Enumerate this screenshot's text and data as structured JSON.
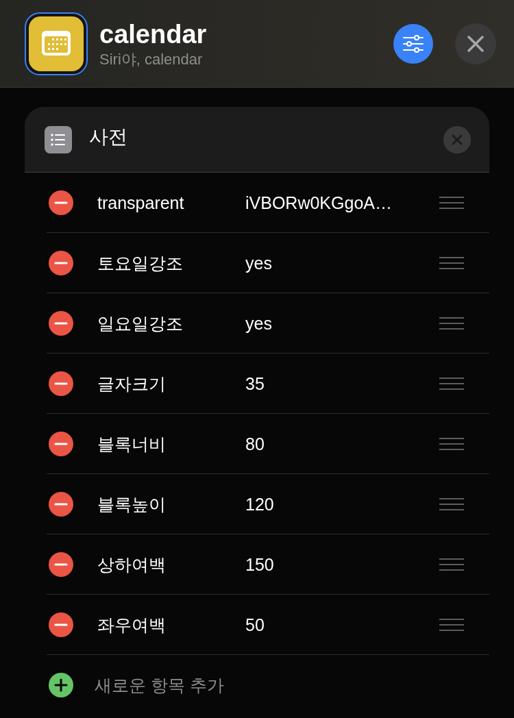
{
  "app": {
    "title": "calendar",
    "subtitle": "Siri야, calendar"
  },
  "dictionary": {
    "title": "사전",
    "items": [
      {
        "key": "transparent",
        "value": "iVBORw0KGgoA…"
      },
      {
        "key": "토요일강조",
        "value": "yes"
      },
      {
        "key": "일요일강조",
        "value": "yes"
      },
      {
        "key": "글자크기",
        "value": "35"
      },
      {
        "key": "블록너비",
        "value": "80"
      },
      {
        "key": "블록높이",
        "value": "120"
      },
      {
        "key": "상하여백",
        "value": "150"
      },
      {
        "key": "좌우여백",
        "value": "50"
      }
    ],
    "add_label": "새로운 항목 추가"
  }
}
